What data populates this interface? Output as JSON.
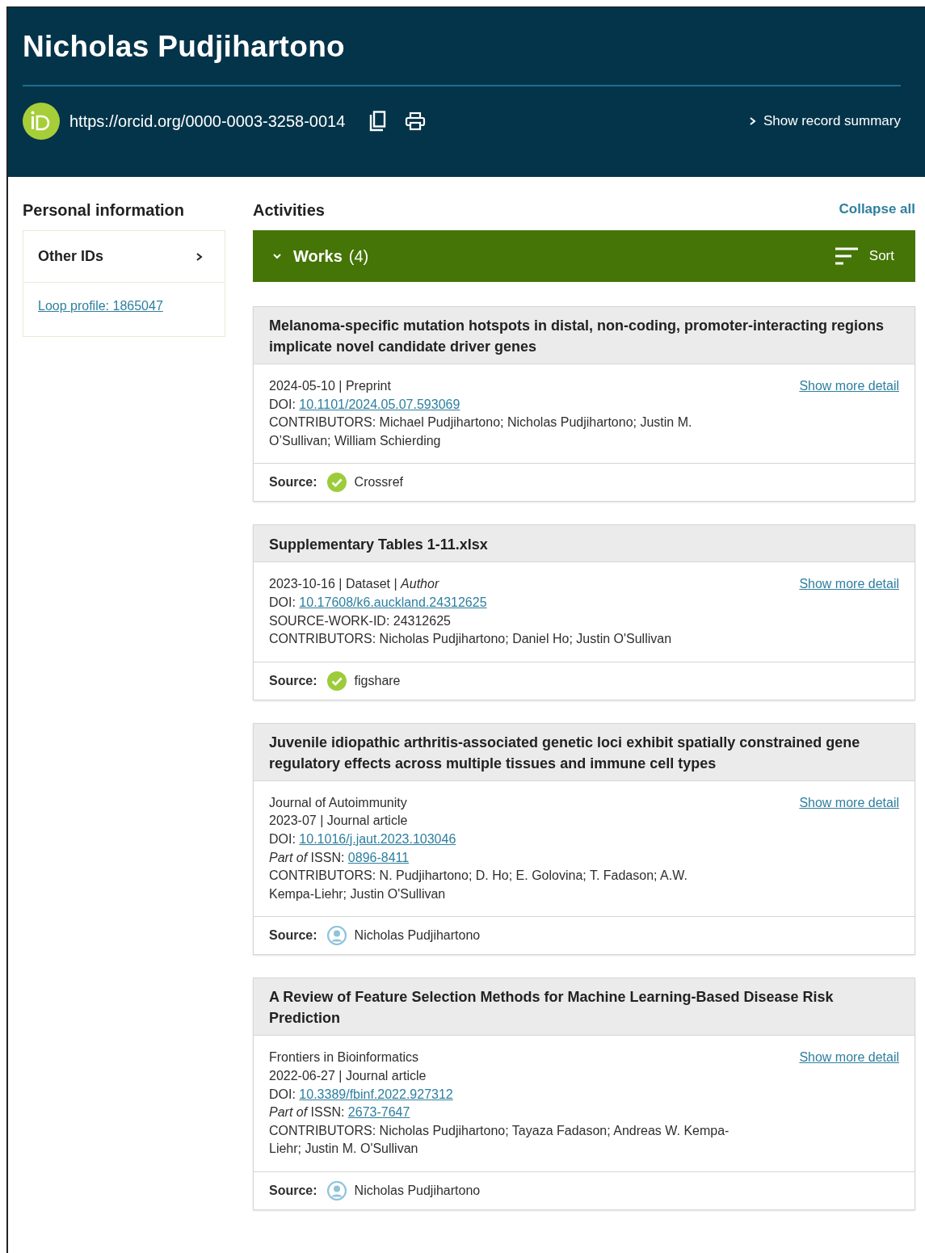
{
  "header": {
    "name": "Nicholas Pudjihartono",
    "orcid_url": "https://orcid.org/0000-0003-3258-0014",
    "summary_link": "Show record summary"
  },
  "sidebar": {
    "title": "Personal information",
    "section": {
      "title": "Other IDs",
      "expanded": false,
      "links": [
        "Loop profile: 1865047"
      ]
    }
  },
  "activities": {
    "title": "Activities",
    "collapse_link": "Collapse all",
    "works_header": {
      "label": "Works",
      "count": "(4)",
      "expanded": true,
      "sort": "Sort"
    },
    "works": [
      {
        "title": "Melanoma-specific mutation hotspots in distal, non-coding, promoter-interacting regions implicate novel candidate driver genes",
        "detail_link": "Show more detail",
        "lines": [
          {
            "kind": "text",
            "text": "2024-05-10 | Preprint"
          },
          {
            "kind": "link",
            "label": "DOI:",
            "link": "10.1101/2024.05.07.593069"
          },
          {
            "kind": "text",
            "text": "CONTRIBUTORS: Michael Pudjihartono; Nicholas Pudjihartono; Justin M. O’Sullivan; William Schierding"
          }
        ],
        "source": {
          "label": "Source:",
          "kind": "verified",
          "name": "Crossref"
        }
      },
      {
        "title": "Supplementary Tables 1-11.xlsx",
        "detail_link": "Show more detail",
        "lines": [
          {
            "kind": "text",
            "text": "2023-10-16 | Dataset | *Author*"
          },
          {
            "kind": "link",
            "label": "DOI:",
            "link": "10.17608/k6.auckland.24312625"
          },
          {
            "kind": "text",
            "text": "SOURCE-WORK-ID: 24312625"
          },
          {
            "kind": "text",
            "text": "CONTRIBUTORS: Nicholas Pudjihartono; Daniel Ho; Justin O'Sullivan"
          }
        ],
        "source": {
          "label": "Source:",
          "kind": "verified",
          "name": "figshare"
        }
      },
      {
        "title": "Juvenile idiopathic arthritis-associated genetic loci exhibit spatially constrained gene regulatory effects across multiple tissues and immune cell types",
        "detail_link": "Show more detail",
        "lines": [
          {
            "kind": "text",
            "text": "Journal of Autoimmunity"
          },
          {
            "kind": "text",
            "text": "2023-07 | Journal article"
          },
          {
            "kind": "link",
            "label": "DOI:",
            "link": "10.1016/j.jaut.2023.103046"
          },
          {
            "kind": "link",
            "label": "*Part of* ISSN:",
            "link": "0896-8411"
          },
          {
            "kind": "text",
            "text": "CONTRIBUTORS: N. Pudjihartono; D. Ho; E. Golovina; T. Fadason; A.W. Kempa-Liehr; Justin O'Sullivan"
          }
        ],
        "source": {
          "label": "Source:",
          "kind": "person",
          "name": "Nicholas Pudjihartono"
        }
      },
      {
        "title": "A Review of Feature Selection Methods for Machine Learning-Based Disease Risk Prediction",
        "detail_link": "Show more detail",
        "lines": [
          {
            "kind": "text",
            "text": "Frontiers in Bioinformatics"
          },
          {
            "kind": "text",
            "text": "2022-06-27 | Journal article"
          },
          {
            "kind": "link",
            "label": "DOI:",
            "link": "10.3389/fbinf.2022.927312"
          },
          {
            "kind": "link",
            "label": "*Part of* ISSN:",
            "link": "2673-7647"
          },
          {
            "kind": "text",
            "text": "CONTRIBUTORS: Nicholas Pudjihartono; Tayaza Fadason; Andreas W. Kempa-Liehr; Justin M. O'Sullivan"
          }
        ],
        "source": {
          "label": "Source:",
          "kind": "person",
          "name": "Nicholas Pudjihartono"
        }
      }
    ]
  }
}
